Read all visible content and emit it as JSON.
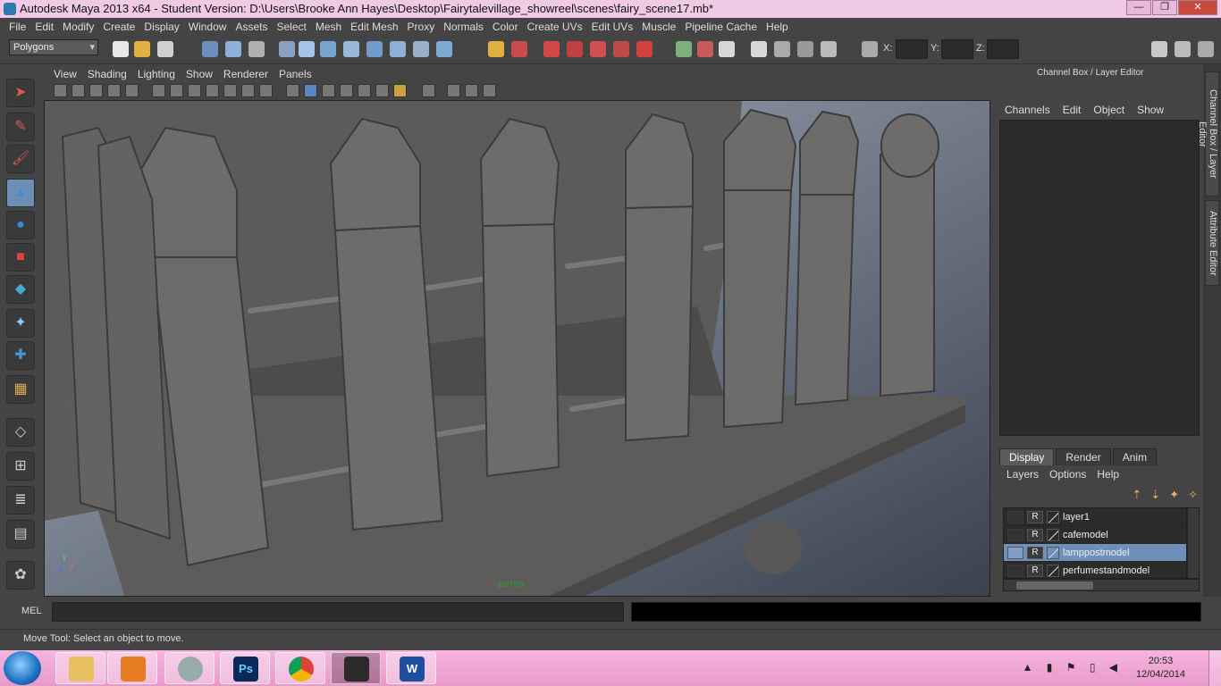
{
  "window": {
    "title": "Autodesk Maya 2013 x64 - Student Version: D:\\Users\\Brooke Ann Hayes\\Desktop\\Fairytalevillage_showreel\\scenes\\fairy_scene17.mb*",
    "minimize": "—",
    "maximize": "❐",
    "close": "✕"
  },
  "menubar": [
    "File",
    "Edit",
    "Modify",
    "Create",
    "Display",
    "Window",
    "Assets",
    "Select",
    "Mesh",
    "Edit Mesh",
    "Proxy",
    "Normals",
    "Color",
    "Create UVs",
    "Edit UVs",
    "Muscle",
    "Pipeline Cache",
    "Help"
  ],
  "statusline": {
    "mode": "Polygons",
    "x_label": "X:",
    "y_label": "Y:",
    "z_label": "Z:"
  },
  "viewport": {
    "menu": [
      "View",
      "Shading",
      "Lighting",
      "Show",
      "Renderer",
      "Panels"
    ],
    "camera": "persp",
    "axis_y": "y",
    "axis_x": "x",
    "axis_z": "z"
  },
  "channel_box": {
    "title": "Channel Box / Layer Editor",
    "menu": [
      "Channels",
      "Edit",
      "Object",
      "Show"
    ]
  },
  "layer_editor": {
    "tabs": [
      "Display",
      "Render",
      "Anim"
    ],
    "active_tab": "Display",
    "menu": [
      "Layers",
      "Options",
      "Help"
    ],
    "layers": [
      {
        "name": "layer1",
        "r": "R"
      },
      {
        "name": "cafemodel",
        "r": "R"
      },
      {
        "name": "lamppostmodel",
        "r": "R",
        "selected": true
      },
      {
        "name": "perfumestandmodel",
        "r": "R"
      }
    ]
  },
  "side_tabs": [
    "Channel Box / Layer Editor",
    "Attribute Editor"
  ],
  "mel": {
    "label": "MEL"
  },
  "help_line": "Move Tool: Select an object to move.",
  "taskbar": {
    "time": "20:53",
    "date": "12/04/2014",
    "apps": [
      {
        "name": "Ps",
        "color": "#0b2a5a"
      },
      {
        "name": "W",
        "color": "#1d4fa0"
      }
    ]
  }
}
